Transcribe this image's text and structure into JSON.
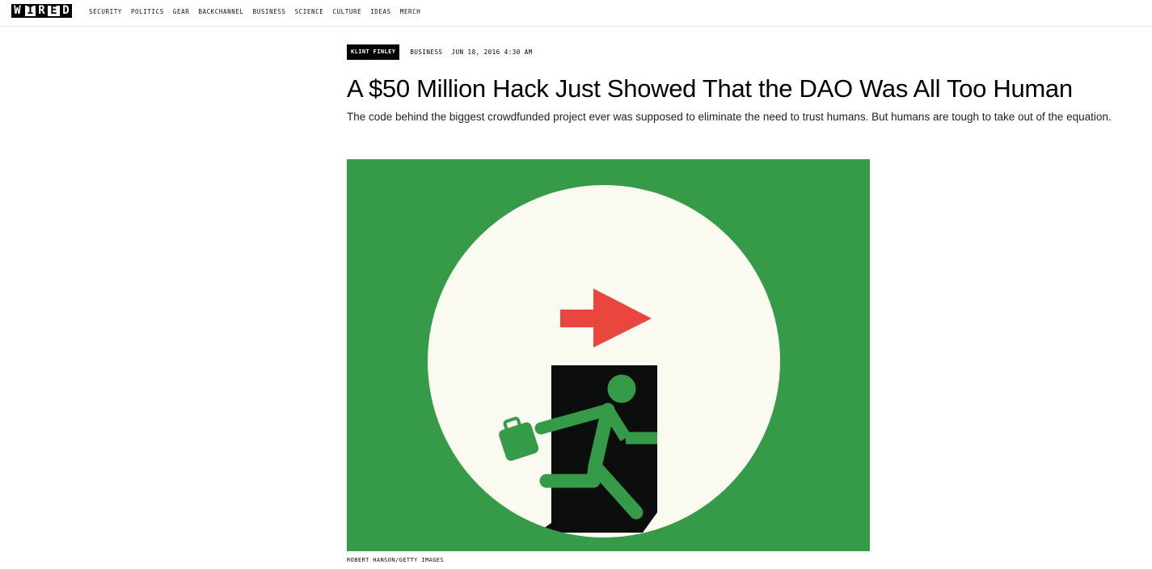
{
  "header": {
    "logo_letters": [
      "W",
      "I",
      "R",
      "E",
      "D"
    ],
    "nav": [
      "SECURITY",
      "POLITICS",
      "GEAR",
      "BACKCHANNEL",
      "BUSINESS",
      "SCIENCE",
      "CULTURE",
      "IDEAS",
      "MERCH"
    ]
  },
  "article": {
    "author": "KLINT FINLEY",
    "category": "BUSINESS",
    "date": "JUN 18, 2016 4:30 AM",
    "title": "A $50 Million Hack Just Showed That the DAO Was All Too Human",
    "dek": "The code behind the biggest crowdfunded project ever was supposed to eliminate the need to trust humans. But humans are tough to take out of the equation.",
    "image_credit": "ROBERT HANSON/GETTY IMAGES"
  },
  "hero_image": {
    "background_color": "#359b48",
    "circle_color": "#fbfaf1",
    "door_color": "#0b0e0c",
    "arrow_color": "#e9473d",
    "figure_color": "#359b48"
  }
}
